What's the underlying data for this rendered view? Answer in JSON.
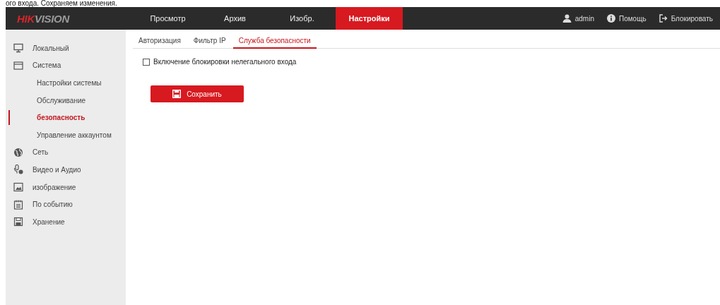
{
  "caption": "ого входа. Сохраняем изменения.",
  "header": {
    "logo": [
      "HIK",
      "VISION"
    ],
    "nav": [
      {
        "label": "Просмотр",
        "selected": false
      },
      {
        "label": "Архив",
        "selected": false
      },
      {
        "label": "Изобр.",
        "selected": false
      },
      {
        "label": "Настройки",
        "selected": true
      }
    ],
    "user": "admin",
    "help": "Помощь",
    "lock": "Блокировать"
  },
  "sidebar": {
    "items": [
      {
        "kind": "group",
        "label": "Локальный",
        "selected": false
      },
      {
        "kind": "group",
        "label": "Система",
        "selected": false
      },
      {
        "kind": "sub",
        "label": "Настройки системы",
        "selected": false
      },
      {
        "kind": "sub",
        "label": "Обслуживание",
        "selected": false
      },
      {
        "kind": "sub",
        "label": "безопасность",
        "selected": true
      },
      {
        "kind": "sub",
        "label": "Управление аккаунтом",
        "selected": false
      },
      {
        "kind": "group",
        "label": "Сеть",
        "selected": false
      },
      {
        "kind": "group",
        "label": "Видео и Аудио",
        "selected": false
      },
      {
        "kind": "group",
        "label": "изображение",
        "selected": false
      },
      {
        "kind": "group",
        "label": "По событию",
        "selected": false
      },
      {
        "kind": "group",
        "label": "Хранение",
        "selected": false
      }
    ]
  },
  "tabs": [
    {
      "label": "Авторизация",
      "selected": false
    },
    {
      "label": "Фильтр IP",
      "selected": false
    },
    {
      "label": "Служба безопасности",
      "selected": true
    }
  ],
  "options": [
    {
      "label": "Включение блокировки нелегального входа",
      "checked": false
    }
  ],
  "save_button": "Сохранить"
}
